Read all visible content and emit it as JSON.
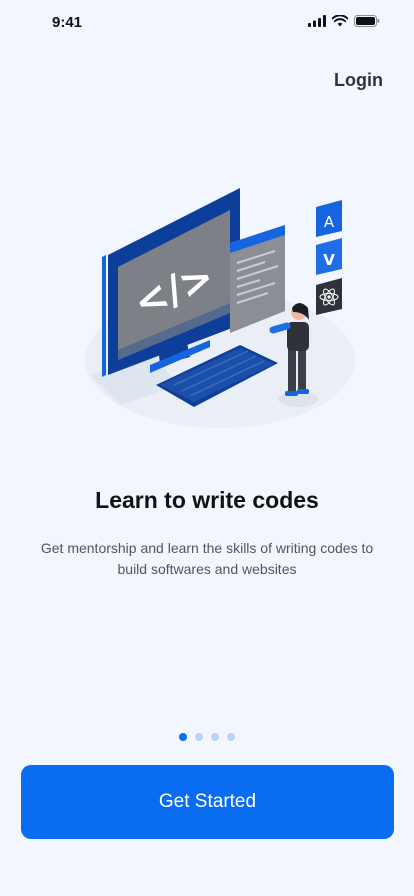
{
  "status_bar": {
    "time": "9:41"
  },
  "header": {
    "login_label": "Login"
  },
  "onboarding": {
    "title": "Learn to write codes",
    "subtitle": "Get mentorship and learn the skills of writing codes to build softwares and websites",
    "page_count": 4,
    "current_page": 1
  },
  "footer": {
    "cta_label": "Get Started"
  },
  "colors": {
    "accent": "#0a6cf0",
    "background": "#f2f7ff",
    "dot_inactive": "#b9d4f8"
  },
  "icons": [
    "signal-icon",
    "wifi-icon",
    "battery-icon",
    "angular-icon",
    "vue-icon",
    "react-icon"
  ]
}
